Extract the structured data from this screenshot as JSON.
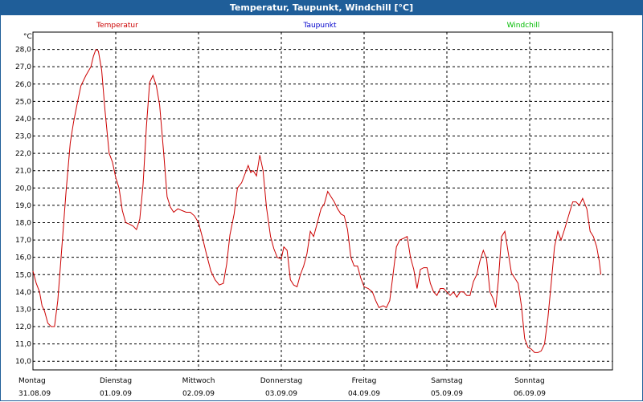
{
  "window": {
    "title": "Temperatur, Taupunkt, Windchill [°C]"
  },
  "chart_data": {
    "type": "line",
    "ylabel": "°C",
    "ylim": [
      9.5,
      29.0
    ],
    "yticks": [
      "10,0",
      "11,0",
      "12,0",
      "13,0",
      "14,0",
      "15,0",
      "16,0",
      "17,0",
      "18,0",
      "19,0",
      "20,0",
      "21,0",
      "22,0",
      "23,0",
      "24,0",
      "25,0",
      "26,0",
      "27,0",
      "28,0"
    ],
    "grid": true,
    "legend_placement": "top",
    "x_range_days": [
      0,
      7
    ],
    "days": [
      {
        "name": "Montag",
        "date": "31.08.09"
      },
      {
        "name": "Dienstag",
        "date": "01.09.09"
      },
      {
        "name": "Mittwoch",
        "date": "02.09.09"
      },
      {
        "name": "Donnerstag",
        "date": "03.09.09"
      },
      {
        "name": "Freitag",
        "date": "04.09.09"
      },
      {
        "name": "Samstag",
        "date": "05.09.09"
      },
      {
        "name": "Sonntag",
        "date": "06.09.09"
      }
    ],
    "series": [
      {
        "name": "Temperatur",
        "color": "#cc0000",
        "points": [
          [
            0.0,
            15.2
          ],
          [
            0.04,
            14.5
          ],
          [
            0.08,
            14.0
          ],
          [
            0.11,
            13.2
          ],
          [
            0.14,
            12.9
          ],
          [
            0.18,
            12.2
          ],
          [
            0.22,
            12.0
          ],
          [
            0.26,
            12.0
          ],
          [
            0.3,
            13.5
          ],
          [
            0.34,
            16.0
          ],
          [
            0.4,
            19.8
          ],
          [
            0.45,
            22.6
          ],
          [
            0.49,
            23.8
          ],
          [
            0.54,
            25.0
          ],
          [
            0.58,
            25.9
          ],
          [
            0.64,
            26.5
          ],
          [
            0.7,
            27.0
          ],
          [
            0.73,
            27.6
          ],
          [
            0.76,
            28.0
          ],
          [
            0.79,
            27.9
          ],
          [
            0.83,
            26.8
          ],
          [
            0.87,
            24.5
          ],
          [
            0.92,
            22.0
          ],
          [
            0.96,
            21.5
          ],
          [
            1.0,
            20.6
          ],
          [
            1.04,
            20.0
          ],
          [
            1.08,
            18.7
          ],
          [
            1.12,
            18.0
          ],
          [
            1.17,
            17.9
          ],
          [
            1.21,
            17.8
          ],
          [
            1.25,
            17.6
          ],
          [
            1.29,
            18.2
          ],
          [
            1.33,
            20.2
          ],
          [
            1.37,
            23.5
          ],
          [
            1.41,
            26.1
          ],
          [
            1.45,
            26.5
          ],
          [
            1.49,
            25.9
          ],
          [
            1.53,
            24.8
          ],
          [
            1.58,
            22.0
          ],
          [
            1.62,
            19.5
          ],
          [
            1.66,
            18.9
          ],
          [
            1.7,
            18.6
          ],
          [
            1.75,
            18.8
          ],
          [
            1.8,
            18.7
          ],
          [
            1.85,
            18.6
          ],
          [
            1.9,
            18.6
          ],
          [
            1.95,
            18.4
          ],
          [
            2.0,
            18.0
          ],
          [
            2.05,
            17.1
          ],
          [
            2.1,
            16.1
          ],
          [
            2.15,
            15.2
          ],
          [
            2.2,
            14.7
          ],
          [
            2.25,
            14.4
          ],
          [
            2.3,
            14.5
          ],
          [
            2.34,
            15.6
          ],
          [
            2.38,
            17.3
          ],
          [
            2.43,
            18.5
          ],
          [
            2.47,
            20.0
          ],
          [
            2.52,
            20.3
          ],
          [
            2.56,
            20.8
          ],
          [
            2.6,
            21.3
          ],
          [
            2.63,
            20.9
          ],
          [
            2.66,
            21.0
          ],
          [
            2.7,
            20.7
          ],
          [
            2.74,
            21.9
          ],
          [
            2.78,
            21.0
          ],
          [
            2.82,
            18.9
          ],
          [
            2.87,
            17.2
          ],
          [
            2.91,
            16.5
          ],
          [
            2.95,
            16.0
          ],
          [
            3.0,
            15.9
          ],
          [
            3.03,
            16.6
          ],
          [
            3.07,
            16.4
          ],
          [
            3.11,
            14.7
          ],
          [
            3.15,
            14.4
          ],
          [
            3.19,
            14.3
          ],
          [
            3.23,
            15.0
          ],
          [
            3.27,
            15.5
          ],
          [
            3.31,
            16.2
          ],
          [
            3.35,
            17.5
          ],
          [
            3.39,
            17.2
          ],
          [
            3.43,
            17.9
          ],
          [
            3.48,
            18.8
          ],
          [
            3.52,
            19.1
          ],
          [
            3.56,
            19.8
          ],
          [
            3.6,
            19.5
          ],
          [
            3.64,
            19.2
          ],
          [
            3.68,
            18.8
          ],
          [
            3.72,
            18.5
          ],
          [
            3.76,
            18.4
          ],
          [
            3.8,
            17.6
          ],
          [
            3.84,
            16.0
          ],
          [
            3.88,
            15.5
          ],
          [
            3.92,
            15.5
          ],
          [
            3.96,
            14.8
          ],
          [
            4.0,
            14.3
          ],
          [
            4.05,
            14.2
          ],
          [
            4.1,
            14.0
          ],
          [
            4.14,
            13.5
          ],
          [
            4.18,
            13.1
          ],
          [
            4.23,
            13.2
          ],
          [
            4.27,
            13.1
          ],
          [
            4.31,
            13.5
          ],
          [
            4.35,
            15.0
          ],
          [
            4.39,
            16.6
          ],
          [
            4.43,
            17.0
          ],
          [
            4.48,
            17.1
          ],
          [
            4.52,
            17.2
          ],
          [
            4.56,
            16.0
          ],
          [
            4.6,
            15.3
          ],
          [
            4.64,
            14.2
          ],
          [
            4.68,
            15.3
          ],
          [
            4.72,
            15.4
          ],
          [
            4.76,
            15.4
          ],
          [
            4.8,
            14.5
          ],
          [
            4.84,
            14.0
          ],
          [
            4.88,
            13.8
          ],
          [
            4.92,
            14.2
          ],
          [
            4.96,
            14.2
          ],
          [
            5.0,
            14.0
          ],
          [
            5.04,
            13.8
          ],
          [
            5.08,
            14.0
          ],
          [
            5.12,
            13.7
          ],
          [
            5.16,
            14.0
          ],
          [
            5.2,
            14.0
          ],
          [
            5.24,
            13.8
          ],
          [
            5.28,
            13.8
          ],
          [
            5.32,
            14.6
          ],
          [
            5.36,
            15.0
          ],
          [
            5.4,
            15.8
          ],
          [
            5.44,
            16.4
          ],
          [
            5.48,
            15.9
          ],
          [
            5.52,
            14.0
          ],
          [
            5.56,
            13.6
          ],
          [
            5.59,
            13.1
          ],
          [
            5.62,
            14.6
          ],
          [
            5.66,
            17.2
          ],
          [
            5.7,
            17.5
          ],
          [
            5.74,
            16.3
          ],
          [
            5.78,
            15.1
          ],
          [
            5.82,
            14.8
          ],
          [
            5.86,
            14.5
          ],
          [
            5.9,
            13.2
          ],
          [
            5.94,
            11.3
          ],
          [
            5.98,
            10.8
          ],
          [
            6.02,
            10.7
          ],
          [
            6.06,
            10.5
          ],
          [
            6.1,
            10.5
          ],
          [
            6.14,
            10.6
          ],
          [
            6.18,
            11.0
          ],
          [
            6.22,
            12.5
          ],
          [
            6.26,
            14.5
          ],
          [
            6.3,
            16.6
          ],
          [
            6.34,
            17.5
          ],
          [
            6.38,
            17.0
          ],
          [
            6.42,
            17.6
          ],
          [
            6.47,
            18.4
          ],
          [
            6.52,
            19.2
          ],
          [
            6.56,
            19.2
          ],
          [
            6.6,
            19.0
          ],
          [
            6.64,
            19.4
          ],
          [
            6.69,
            18.8
          ],
          [
            6.73,
            17.5
          ],
          [
            6.77,
            17.2
          ],
          [
            6.81,
            16.6
          ],
          [
            6.84,
            15.8
          ],
          [
            6.86,
            15.0
          ]
        ]
      },
      {
        "name": "Taupunkt",
        "color": "#0000cc",
        "points": []
      },
      {
        "name": "Windchill",
        "color": "#00bb00",
        "points": []
      }
    ]
  }
}
